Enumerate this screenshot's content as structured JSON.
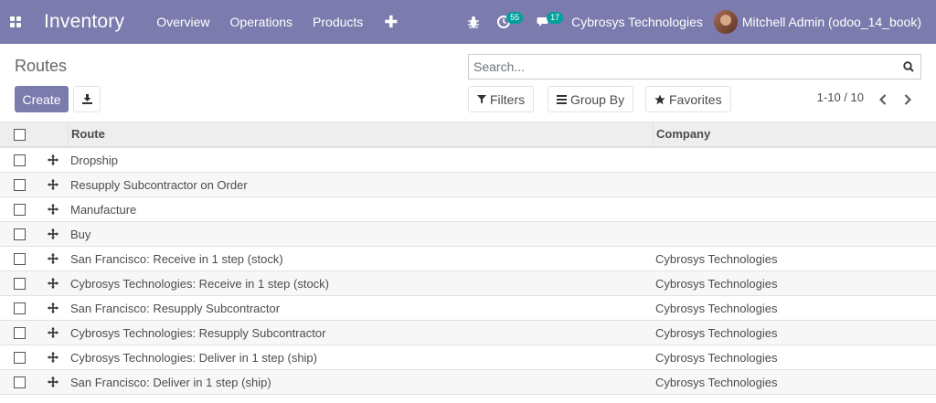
{
  "navbar": {
    "app_name": "Inventory",
    "menu": [
      "Overview",
      "Operations",
      "Products"
    ],
    "plus_label": "✚",
    "activity_count": "55",
    "message_count": "17",
    "company": "Cybrosys Technologies",
    "user": "Mitchell Admin (odoo_14_book)"
  },
  "control": {
    "breadcrumb": "Routes",
    "create_label": "Create",
    "search_placeholder": "Search...",
    "filters_label": "Filters",
    "groupby_label": "Group By",
    "favorites_label": "Favorites",
    "pager": "1-10 / 10"
  },
  "table": {
    "columns": [
      "Route",
      "Company"
    ],
    "rows": [
      {
        "route": "Dropship",
        "company": ""
      },
      {
        "route": "Resupply Subcontractor on Order",
        "company": ""
      },
      {
        "route": "Manufacture",
        "company": ""
      },
      {
        "route": "Buy",
        "company": ""
      },
      {
        "route": "San Francisco: Receive in 1 step (stock)",
        "company": "Cybrosys Technologies"
      },
      {
        "route": "Cybrosys Technologies: Receive in 1 step (stock)",
        "company": "Cybrosys Technologies"
      },
      {
        "route": "San Francisco: Resupply Subcontractor",
        "company": "Cybrosys Technologies"
      },
      {
        "route": "Cybrosys Technologies: Resupply Subcontractor",
        "company": "Cybrosys Technologies"
      },
      {
        "route": "Cybrosys Technologies: Deliver in 1 step (ship)",
        "company": "Cybrosys Technologies"
      },
      {
        "route": "San Francisco: Deliver in 1 step (ship)",
        "company": "Cybrosys Technologies"
      }
    ]
  },
  "colors": {
    "brand": "#7c7bad",
    "badge": "#00a09d"
  },
  "icons": [
    "apps-icon",
    "bug-icon",
    "activity-icon",
    "chat-icon",
    "download-icon",
    "search-icon",
    "filter-icon",
    "group-by-icon",
    "star-icon",
    "chevron-left-icon",
    "chevron-right-icon",
    "drag-handle-icon"
  ]
}
